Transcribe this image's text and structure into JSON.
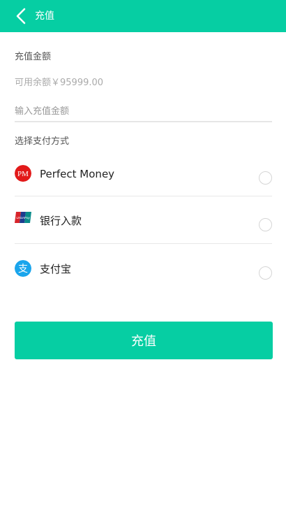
{
  "header": {
    "title": "充值"
  },
  "form": {
    "amount_label": "充值金额",
    "balance_text": "可用余额￥95999.00",
    "amount_placeholder": "输入充值金额",
    "method_label": "选择支付方式"
  },
  "payment_methods": [
    {
      "name": "Perfect Money",
      "icon": "perfect-money-icon",
      "icon_text": "PM",
      "color": "#e21a1a",
      "selected": false
    },
    {
      "name": "银行入款",
      "icon": "unionpay-icon",
      "icon_text": "UnionPay",
      "color": "#d7242b",
      "selected": false
    },
    {
      "name": "支付宝",
      "icon": "alipay-icon",
      "icon_text": "支",
      "color": "#1aa5ec",
      "selected": false
    }
  ],
  "submit_label": "充值",
  "colors": {
    "accent": "#06cea3"
  }
}
